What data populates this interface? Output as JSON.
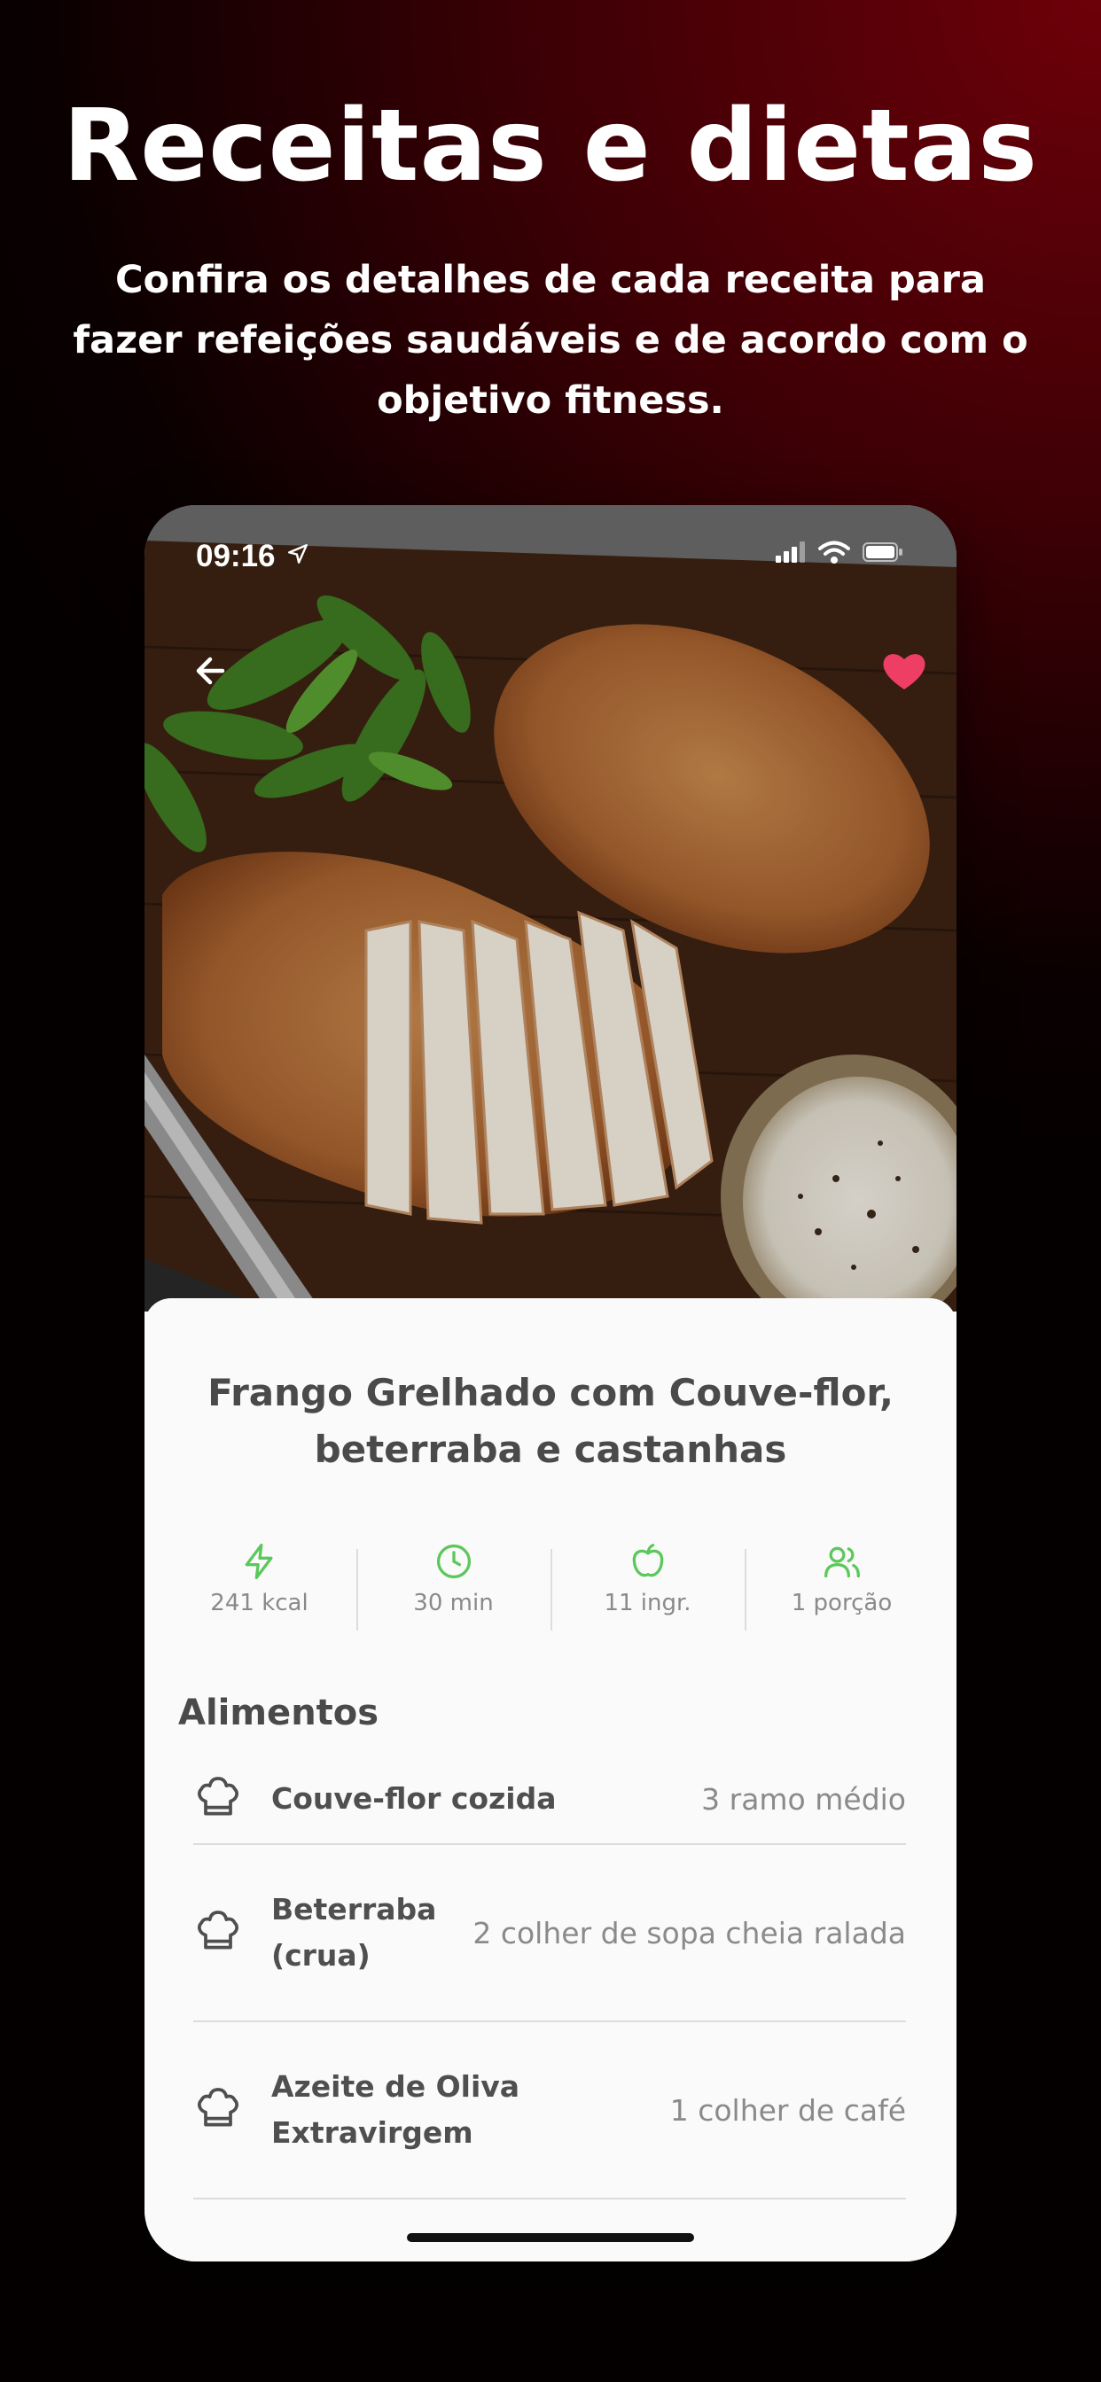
{
  "headline": "Receitas e dietas",
  "subheadline": "Confira os detalhes de cada receita para fazer refeições saudáveis e de acordo com o objetivo fitness.",
  "status_bar": {
    "time": "09:16"
  },
  "recipe": {
    "title": "Frango Grelhado com Couve-flor, beterraba e castanhas",
    "stats": [
      {
        "icon": "lightning-icon",
        "label": "241 kcal"
      },
      {
        "icon": "clock-icon",
        "label": "30 min"
      },
      {
        "icon": "apple-icon",
        "label": "11 ingr."
      },
      {
        "icon": "people-icon",
        "label": "1 porção"
      }
    ]
  },
  "foods_section": {
    "title": "Alimentos",
    "items": [
      {
        "name": "Couve-flor cozida",
        "quantity": "3 ramo médio"
      },
      {
        "name": "Beterraba (crua)",
        "quantity": "2 colher de sopa cheia ralada"
      },
      {
        "name": "Azeite de Oliva Extravirgem",
        "quantity": "1 colher de café"
      }
    ]
  },
  "colors": {
    "accent_green": "#5cc85c",
    "favorite_pink": "#ee3e63",
    "background_dark_red": "#6e0009"
  }
}
